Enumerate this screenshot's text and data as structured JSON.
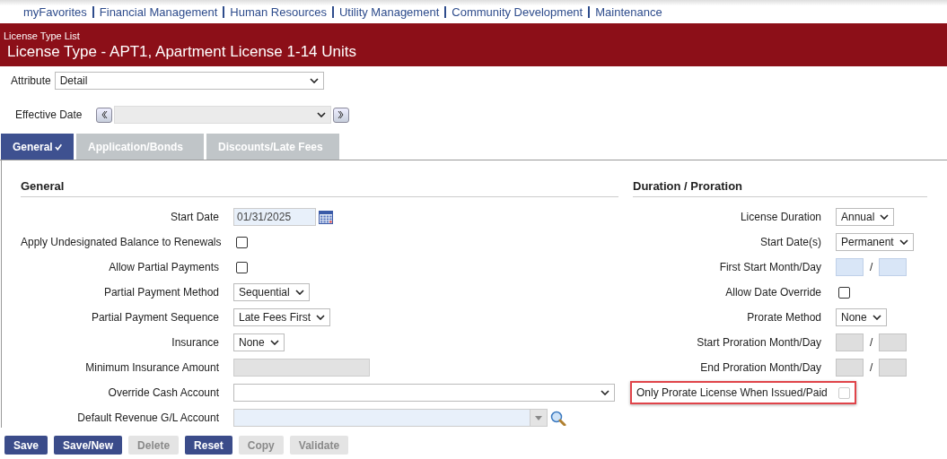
{
  "nav": [
    "myFavorites",
    "Financial Management",
    "Human Resources",
    "Utility Management",
    "Community Development",
    "Maintenance"
  ],
  "header": {
    "breadcrumb": "License Type List",
    "title": "License Type - APT1, Apartment License 1-14 Units"
  },
  "attribute": {
    "label": "Attribute",
    "value": "Detail"
  },
  "effective_date": {
    "label": "Effective Date"
  },
  "tabs": [
    {
      "label": "General",
      "selected": true
    },
    {
      "label": "Application/Bonds",
      "selected": false
    },
    {
      "label": "Discounts/Late Fees",
      "selected": false
    }
  ],
  "general": {
    "heading": "General",
    "fields": [
      {
        "kind": "date",
        "label": "Start Date",
        "value": "01/31/2025"
      },
      {
        "kind": "checkbox",
        "label": "Apply Undesignated Balance to Renewals",
        "checked": false,
        "disabled": false
      },
      {
        "kind": "checkbox",
        "label": "Allow Partial Payments",
        "checked": false,
        "disabled": false
      },
      {
        "kind": "select",
        "label": "Partial Payment Method",
        "value": "Sequential"
      },
      {
        "kind": "select",
        "label": "Partial Payment Sequence",
        "value": "Late Fees First"
      },
      {
        "kind": "select",
        "label": "Insurance",
        "value": "None"
      },
      {
        "kind": "text",
        "label": "Minimum Insurance Amount",
        "disabled": true
      },
      {
        "kind": "wide-select",
        "label": "Override Cash Account"
      },
      {
        "kind": "lookup",
        "label": "Default Revenue G/L Account"
      }
    ]
  },
  "duration": {
    "heading": "Duration / Proration",
    "fields": [
      {
        "kind": "select",
        "label": "License Duration",
        "value": "Annual"
      },
      {
        "kind": "select",
        "label": "Start Date(s)",
        "value": "Permanent"
      },
      {
        "kind": "monthday",
        "label": "First Start Month/Day",
        "separator": "/",
        "disabled": false
      },
      {
        "kind": "checkbox",
        "label": "Allow Date Override",
        "checked": false,
        "disabled": false
      },
      {
        "kind": "select",
        "label": "Prorate Method",
        "value": "None"
      },
      {
        "kind": "monthday",
        "label": "Start Proration Month/Day",
        "separator": "/",
        "disabled": true
      },
      {
        "kind": "monthday",
        "label": "End Proration Month/Day",
        "separator": "/",
        "disabled": true
      },
      {
        "kind": "checkbox",
        "label": "Only Prorate License When Issued/Paid",
        "checked": false,
        "disabled": true,
        "highlighted": true
      }
    ]
  },
  "buttons": [
    {
      "label": "Save",
      "disabled": false
    },
    {
      "label": "Save/New",
      "disabled": false
    },
    {
      "label": "Delete",
      "disabled": true
    },
    {
      "label": "Reset",
      "disabled": false
    },
    {
      "label": "Copy",
      "disabled": true
    },
    {
      "label": "Validate",
      "disabled": true
    }
  ]
}
